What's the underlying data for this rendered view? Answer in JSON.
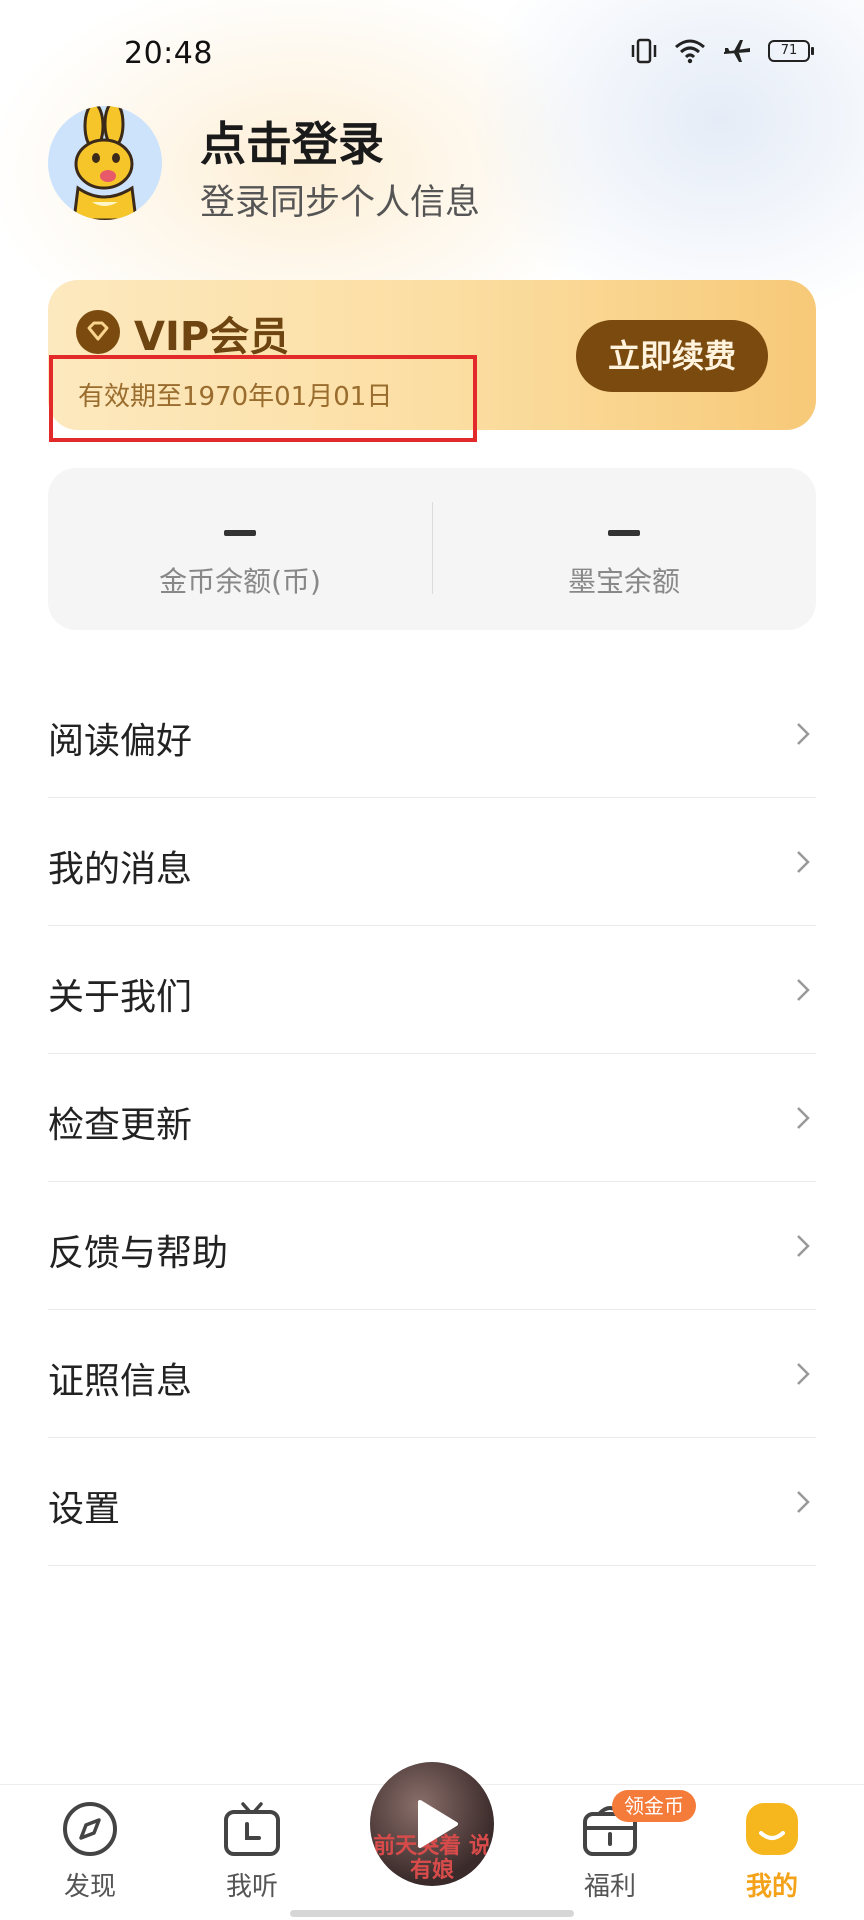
{
  "status_bar": {
    "time": "20:48",
    "battery": "71"
  },
  "profile": {
    "title": "点击登录",
    "subtitle": "登录同步个人信息"
  },
  "vip": {
    "title": "VIP会员",
    "expire_text": "有效期至1970年01月01日",
    "renew_label": "立即续费"
  },
  "balance": [
    {
      "value": "–",
      "label": "金币余额(币)"
    },
    {
      "value": "–",
      "label": "墨宝余额"
    }
  ],
  "menu": [
    {
      "label": "阅读偏好"
    },
    {
      "label": "我的消息"
    },
    {
      "label": "关于我们"
    },
    {
      "label": "检查更新"
    },
    {
      "label": "反馈与帮助"
    },
    {
      "label": "证照信息"
    },
    {
      "label": "设置"
    }
  ],
  "nav": {
    "items": [
      {
        "label": "发现",
        "icon": "compass-icon"
      },
      {
        "label": "我听",
        "icon": "tv-clock-icon"
      },
      {
        "label": "福利",
        "icon": "gift-bag-icon"
      },
      {
        "label": "我的",
        "icon": "smile-face-icon",
        "active": true
      }
    ],
    "player_cover_text": "前天哭着 说有娘",
    "welfare_badge": "领金币"
  },
  "colors": {
    "accent": "#f4a21a",
    "vip_brown": "#7a4a0e",
    "highlight": "#e22a2a"
  }
}
